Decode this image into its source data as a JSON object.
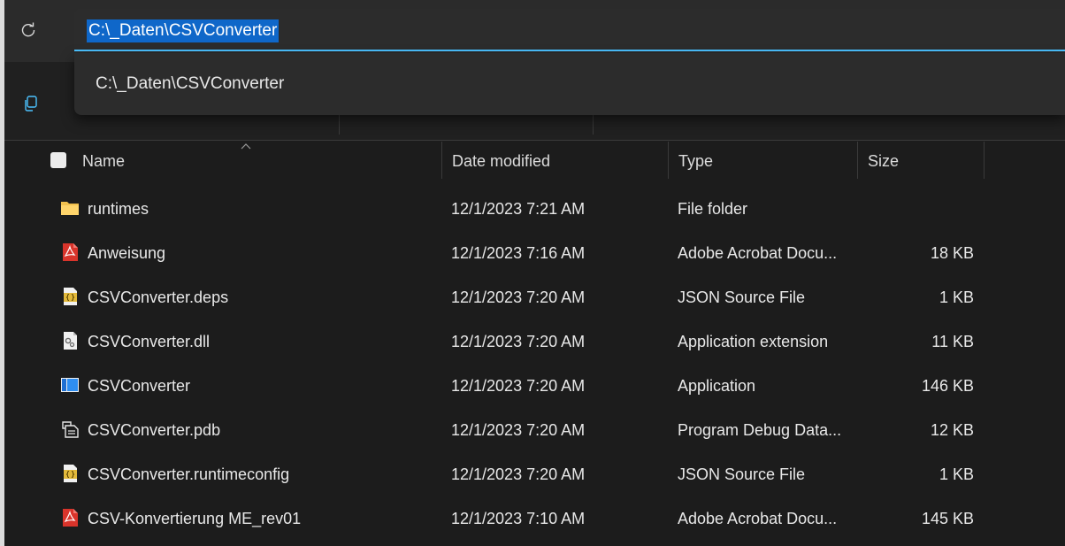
{
  "address_bar": {
    "path": "C:\\_Daten\\CSVConverter",
    "suggestion": "C:\\_Daten\\CSVConverter"
  },
  "columns": {
    "name": "Name",
    "date": "Date modified",
    "type": "Type",
    "size": "Size"
  },
  "files": [
    {
      "name": "runtimes",
      "date": "12/1/2023 7:21 AM",
      "type": "File folder",
      "size": "",
      "icon": "folder-icon"
    },
    {
      "name": "Anweisung",
      "date": "12/1/2023 7:16 AM",
      "type": "Adobe Acrobat Docu...",
      "size": "18 KB",
      "icon": "pdf-icon"
    },
    {
      "name": "CSVConverter.deps",
      "date": "12/1/2023 7:20 AM",
      "type": "JSON Source File",
      "size": "1 KB",
      "icon": "json-file-icon"
    },
    {
      "name": "CSVConverter.dll",
      "date": "12/1/2023 7:20 AM",
      "type": "Application extension",
      "size": "11 KB",
      "icon": "dll-file-icon"
    },
    {
      "name": "CSVConverter",
      "date": "12/1/2023 7:20 AM",
      "type": "Application",
      "size": "146 KB",
      "icon": "application-icon"
    },
    {
      "name": "CSVConverter.pdb",
      "date": "12/1/2023 7:20 AM",
      "type": "Program Debug Data...",
      "size": "12 KB",
      "icon": "pdb-file-icon"
    },
    {
      "name": "CSVConverter.runtimeconfig",
      "date": "12/1/2023 7:20 AM",
      "type": "JSON Source File",
      "size": "1 KB",
      "icon": "json-file-icon"
    },
    {
      "name": "CSV-Konvertierung ME_rev01",
      "date": "12/1/2023 7:10 AM",
      "type": "Adobe Acrobat Docu...",
      "size": "145 KB",
      "icon": "pdf-icon"
    }
  ],
  "colors": {
    "accent": "#4cc2ff",
    "selection": "#0f67c9",
    "folder": "#f2c14e",
    "pdf": "#d9342b"
  }
}
